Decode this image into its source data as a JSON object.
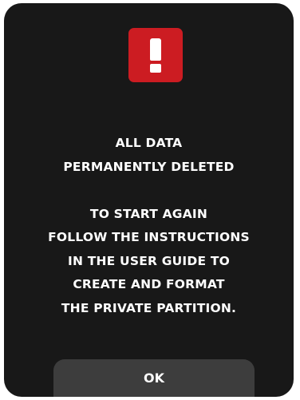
{
  "alert": {
    "icon": "exclamation-icon",
    "icon_color": "#cc1c22"
  },
  "message": {
    "heading_lines": [
      "ALL DATA",
      "PERMANENTLY DELETED"
    ],
    "body_lines": [
      "TO START AGAIN",
      "FOLLOW THE INSTRUCTIONS",
      "IN THE USER GUIDE TO",
      "CREATE AND FORMAT",
      "THE PRIVATE PARTITION."
    ]
  },
  "actions": {
    "ok_label": "OK"
  }
}
